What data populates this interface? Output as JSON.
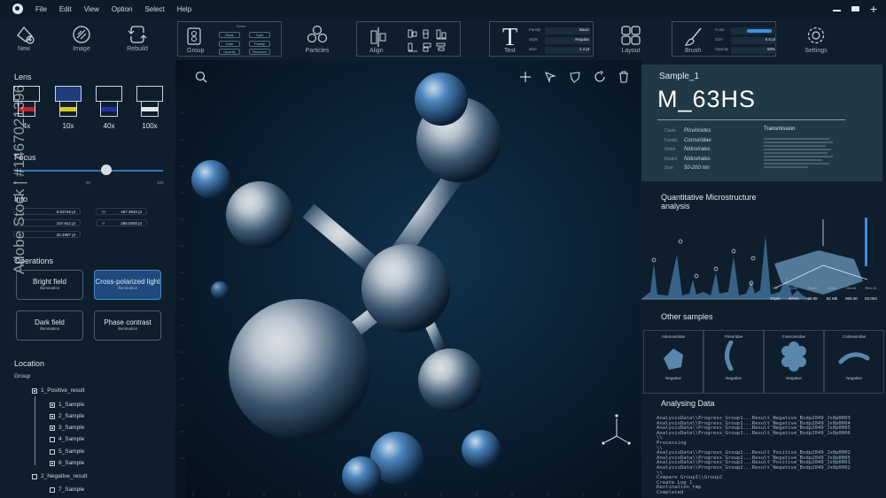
{
  "menu": [
    "File",
    "Edit",
    "View",
    "Option",
    "Select",
    "Help"
  ],
  "toolbar": {
    "new": "New",
    "image": "Image",
    "rebuild": "Rebuild",
    "group": "Group",
    "group_title": "Some",
    "group_chips": [
      "Rank",
      "Type",
      "Date",
      "Family",
      "Opacity",
      "Structure"
    ],
    "particles": "Particles",
    "align": "Align",
    "text": "Text",
    "text_glyph": "T",
    "text_fields": [
      {
        "label": "Family",
        "value": "Basic"
      },
      {
        "label": "Style",
        "value": "Regular"
      },
      {
        "label": "Size",
        "value": "1.4 pt"
      }
    ],
    "layout": "Layout",
    "brush": "Brush",
    "brush_fields": [
      {
        "label": "Color",
        "value": ""
      },
      {
        "label": "Size",
        "value": "5.6 pt"
      },
      {
        "label": "Opacity",
        "value": "50%"
      }
    ],
    "settings": "Settings"
  },
  "left": {
    "lens_title": "Lens",
    "lenses": [
      {
        "label": "4x",
        "color": "#c0202a"
      },
      {
        "label": "10x",
        "color": "#d8c820"
      },
      {
        "label": "40x",
        "color": "#2030a0"
      },
      {
        "label": "100x",
        "color": "#e0e6ec"
      }
    ],
    "focus_title": "Focus",
    "focus_ticks": [
      "0",
      "50",
      "100"
    ],
    "focus_value": 0.62,
    "info_title": "Info",
    "info": [
      {
        "k": "X",
        "v": "5.83746 pt"
      },
      {
        "k": "W",
        "v": "487.3940 pt"
      },
      {
        "k": "y",
        "v": "167.642 pt"
      },
      {
        "k": "H",
        "v": "298.0000 pt"
      },
      {
        "k": "z",
        "v": "20.4987 pt"
      }
    ],
    "operations_title": "Operations",
    "operations": [
      {
        "t1": "Bright field",
        "t2": "illumination"
      },
      {
        "t1": "Cross-polarized light",
        "t2": "illumination"
      },
      {
        "t1": "Dark field",
        "t2": "illumination"
      },
      {
        "t1": "Phase contrast",
        "t2": "illumination"
      }
    ],
    "location_title": "Location",
    "location_group": "Group",
    "tree": [
      {
        "label": "1_Positive_result",
        "on": true
      },
      {
        "label": "1_Sample",
        "on": true
      },
      {
        "label": "2_Sample",
        "on": true
      },
      {
        "label": "3_Sample",
        "on": true
      },
      {
        "label": "4_Sample",
        "on": false
      },
      {
        "label": "5_Sample",
        "on": false
      },
      {
        "label": "6_Sample",
        "on": true
      },
      {
        "label": "2_Negative_result",
        "on": false
      },
      {
        "label": "7_Sample",
        "on": false
      }
    ]
  },
  "watermark": "Adobe Stock | #1467021396",
  "right": {
    "sample_label": "Sample_1",
    "sample_name": "M_63HS",
    "specs": [
      {
        "k": "Class",
        "v": "Pisviricetes"
      },
      {
        "k": "Family",
        "v": "Coroviridae"
      },
      {
        "k": "Order",
        "v": "Nidovirales"
      },
      {
        "k": "Realm",
        "v": "Nidovirales"
      },
      {
        "k": "Size",
        "v": "50-200 nm"
      }
    ],
    "transmission_title": "Transmission",
    "analysis_title": "Quantitative Microstructure analysis",
    "stats": [
      {
        "k": "HV",
        "v": "27μm"
      },
      {
        "k": "GG2",
        "v": "87nm"
      },
      {
        "k": "Pixel2",
        "v": "29.89"
      },
      {
        "k": "Q MK",
        "v": "92 Mb"
      },
      {
        "k": "Dev11",
        "v": "906.00"
      },
      {
        "k": "Res 24",
        "v": "93.004"
      }
    ],
    "other_title": "Other samples",
    "others": [
      {
        "name": "Adenoviridae",
        "result": "Negative"
      },
      {
        "name": "Filoviridae",
        "result": "Negative"
      },
      {
        "name": "Framoviridae",
        "result": "Negative"
      },
      {
        "name": "Colmaviridae",
        "result": "Negative"
      }
    ],
    "data_title": "Analysing Data",
    "log": "AnalysisData\\\\Progress_Group1...Result_Negative_Bsdp2049_Js0p0003\nAnalysisData\\\\Progress_Group1...Result_Negative_Bsdp2049_Js0p0004\nAnalysisData\\\\Progress_Group1...Result_Negative_Bsdp2049_Js0p0005\nAnalysisData\\\\Progress_Group1...Result_Negative_Bsdp2049_Js0p0006\n\\\\\nProcessing\n\\\\\nAnalysisData\\\\Progress_Group2...Result_Positive_Bsdp2049_Js0p0002\nAnalysisData\\\\Progress_Group2...Result_Negative_Bsdp2049_Js0p0005\nAnalysisData\\\\Progress_Group2...Result_Positive_Bsdp2049_Js0p0001\nAnalysisData\\\\Progress_Group2...Result_Negative_Bsdp2049_Js0p0002\n\\\\\nCompare Group1\\\\Group2\nCreate Log 1\nDestination_tmp\nCompleted"
  }
}
